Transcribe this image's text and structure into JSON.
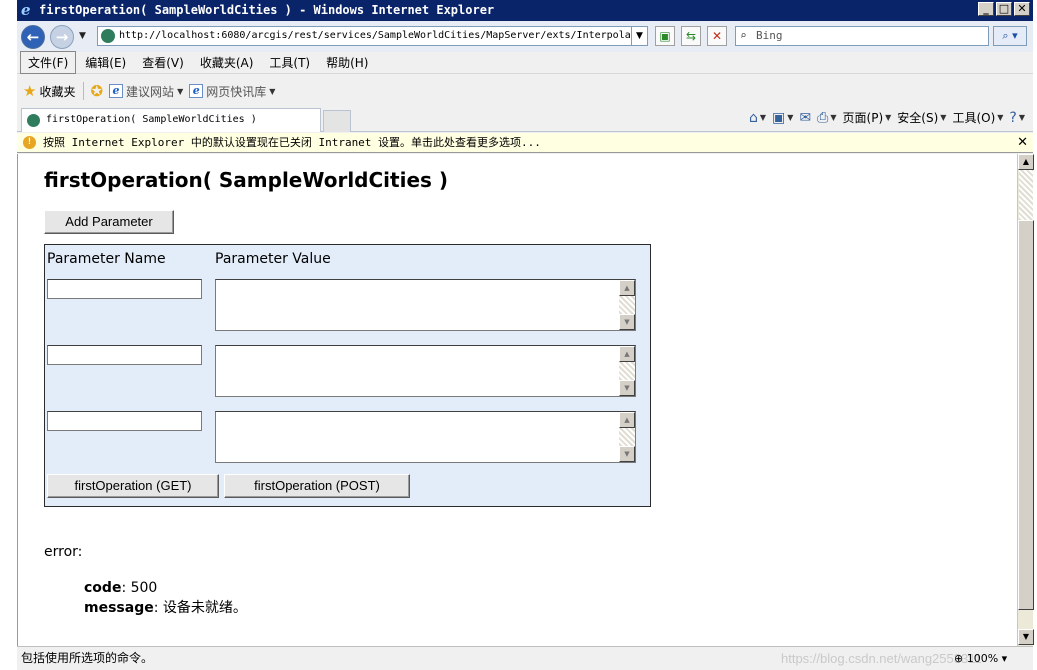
{
  "window": {
    "title": "firstOperation( SampleWorldCities ) - Windows Internet Explorer",
    "min": "_",
    "max": "□",
    "close": "✕"
  },
  "address": {
    "url": "http://localhost:6080/arcgis/rest/services/SampleWorldCities/MapServer/exts/Interpola",
    "search_placeholder": "Bing"
  },
  "menu": [
    "文件(F)",
    "编辑(E)",
    "查看(V)",
    "收藏夹(A)",
    "工具(T)",
    "帮助(H)"
  ],
  "favorites": {
    "label": "收藏夹",
    "suggested": "建议网站",
    "slices": "网页快讯库"
  },
  "tab": {
    "title": "firstOperation( SampleWorldCities )"
  },
  "commands": {
    "page": "页面(P)",
    "safety": "安全(S)",
    "tools": "工具(O)"
  },
  "infobar": {
    "text": "按照 Internet Explorer 中的默认设置现在已关闭 Intranet 设置。单击此处查看更多选项...",
    "close": "✕"
  },
  "page": {
    "title": "firstOperation( SampleWorldCities )",
    "add_parameter": "Add Parameter",
    "col_name": "Parameter Name",
    "col_value": "Parameter Value",
    "rows": [
      {
        "name": "",
        "value": ""
      },
      {
        "name": "",
        "value": ""
      },
      {
        "name": "",
        "value": ""
      }
    ],
    "get_button": "firstOperation (GET)",
    "post_button": "firstOperation (POST)",
    "error": {
      "label": "error",
      "code_key": "code",
      "code_value": "500",
      "message_key": "message",
      "message_value": "设备未就绪。"
    }
  },
  "status": {
    "text": "包括使用所选项的命令。",
    "watermark": "https://blog.csdn.net/wang2553311",
    "zoom": "100%"
  }
}
